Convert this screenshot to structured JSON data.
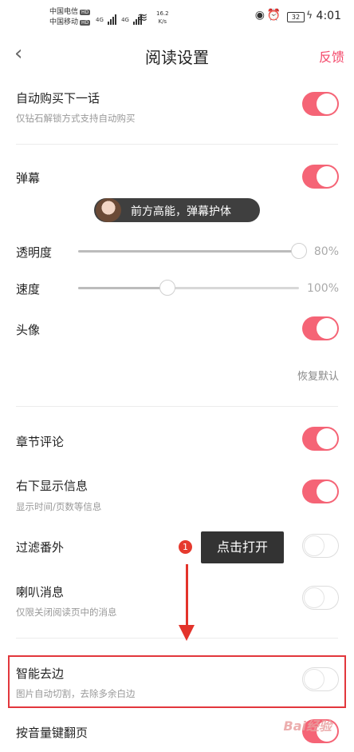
{
  "status_bar": {
    "carrier1": "中国电信",
    "carrier2": "中国移动",
    "hd": "HD",
    "network": "4G",
    "speed_value": "16.2",
    "speed_unit": "K/s",
    "battery": "32",
    "time": "4:01"
  },
  "header": {
    "back_icon": "‹",
    "title": "阅读设置",
    "feedback": "反馈"
  },
  "settings": {
    "auto_buy": {
      "label": "自动购买下一话",
      "sub": "仅钻石解锁方式支持自动购买",
      "on": true
    },
    "danmaku": {
      "label": "弹幕",
      "on": true,
      "preview": "前方高能，弹幕护体"
    },
    "opacity": {
      "label": "透明度",
      "value_text": "80%",
      "level": 1.0
    },
    "speed": {
      "label": "速度",
      "value_text": "100%",
      "level": 0.4
    },
    "avatar": {
      "label": "头像",
      "on": true
    },
    "reset": "恢复默认",
    "chapter_comment": {
      "label": "章节评论",
      "on": true
    },
    "bottom_right_info": {
      "label": "右下显示信息",
      "sub": "显示时间/页数等信息",
      "on": true
    },
    "filter_extra": {
      "label": "过滤番外",
      "on": false
    },
    "speaker_msg": {
      "label": "喇叭消息",
      "sub": "仅限关闭阅读页中的消息",
      "on": false
    },
    "smart_crop": {
      "label": "智能去边",
      "sub": "图片自动切割，去除多余白边",
      "on": false
    },
    "volume_key": {
      "label": "按音量键翻页",
      "on": true
    }
  },
  "annotation": {
    "step": "1",
    "tip": "点击打开"
  },
  "watermark": "Bai经验"
}
